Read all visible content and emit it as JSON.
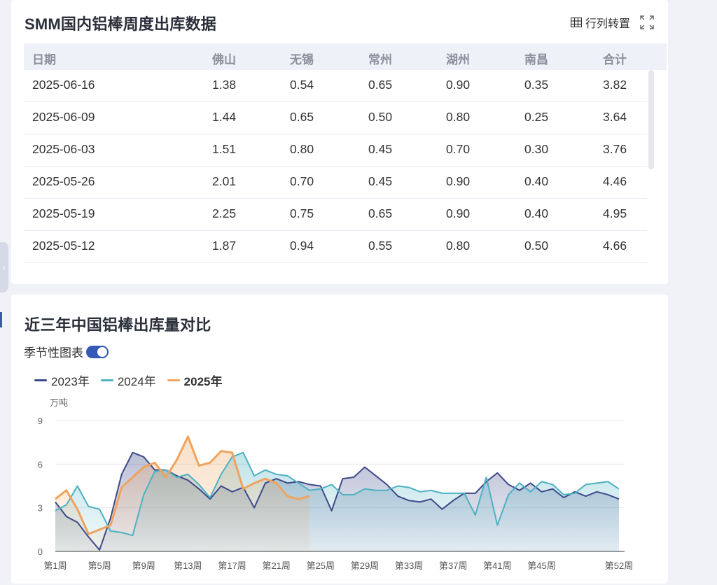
{
  "table_card": {
    "title": "SMM国内铝棒周度出库数据",
    "transpose_label": "行列转置",
    "columns": [
      "日期",
      "佛山",
      "无锡",
      "常州",
      "湖州",
      "南昌",
      "合计"
    ],
    "rows": [
      [
        "2025-06-16",
        "1.38",
        "0.54",
        "0.65",
        "0.90",
        "0.35",
        "3.82"
      ],
      [
        "2025-06-09",
        "1.44",
        "0.65",
        "0.50",
        "0.80",
        "0.25",
        "3.64"
      ],
      [
        "2025-06-03",
        "1.51",
        "0.80",
        "0.45",
        "0.70",
        "0.30",
        "3.76"
      ],
      [
        "2025-05-26",
        "2.01",
        "0.70",
        "0.45",
        "0.90",
        "0.40",
        "4.46"
      ],
      [
        "2025-05-19",
        "2.25",
        "0.75",
        "0.65",
        "0.90",
        "0.40",
        "4.95"
      ],
      [
        "2025-05-12",
        "1.87",
        "0.94",
        "0.55",
        "0.80",
        "0.50",
        "4.66"
      ]
    ]
  },
  "chart_card": {
    "title": "近三年中国铝棒出库量对比",
    "seasonal_toggle_label": "季节性图表",
    "seasonal_toggle_on": true
  },
  "chart_data": {
    "type": "line",
    "yunit": "万吨",
    "ylim": [
      0,
      9
    ],
    "yticks": [
      0,
      3,
      6,
      9
    ],
    "xtick_labels": [
      "第1周",
      "第5周",
      "第9周",
      "第13周",
      "第17周",
      "第21周",
      "第25周",
      "第29周",
      "第33周",
      "第37周",
      "第41周",
      "第45周",
      "第52周"
    ],
    "xtick_weeks": [
      1,
      5,
      9,
      13,
      17,
      21,
      25,
      29,
      33,
      37,
      41,
      45,
      52
    ],
    "grid": true,
    "legend_position": "top-left",
    "series": [
      {
        "name": "2023年",
        "color": "#3e4a89",
        "values": [
          3.4,
          2.4,
          2.0,
          1.0,
          0.1,
          2.3,
          5.3,
          6.8,
          6.5,
          5.6,
          5.6,
          5.2,
          4.9,
          4.3,
          3.6,
          4.5,
          4.1,
          4.4,
          3.0,
          4.7,
          5.0,
          4.7,
          4.8,
          4.6,
          4.5,
          2.8,
          5.0,
          5.1,
          5.8,
          5.2,
          4.6,
          3.8,
          3.5,
          3.4,
          3.6,
          2.9,
          3.5,
          4.0,
          4.0,
          4.8,
          5.4,
          4.6,
          4.2,
          4.7,
          4.1,
          4.3,
          3.7,
          4.1,
          3.8,
          4.1,
          3.9,
          3.6
        ]
      },
      {
        "name": "2024年",
        "color": "#4db1c2",
        "values": [
          2.8,
          3.2,
          4.5,
          3.1,
          2.9,
          1.4,
          1.3,
          1.1,
          3.9,
          5.5,
          5.6,
          5.1,
          5.3,
          4.6,
          3.7,
          5.3,
          6.5,
          6.8,
          5.2,
          5.6,
          5.3,
          5.2,
          4.7,
          4.2,
          4.3,
          4.6,
          3.9,
          3.9,
          4.3,
          4.2,
          4.2,
          4.5,
          4.4,
          4.1,
          4.2,
          4.0,
          4.0,
          4.0,
          2.5,
          5.1,
          1.8,
          3.9,
          4.7,
          4.1,
          4.8,
          4.6,
          3.9,
          4.0,
          4.6,
          4.7,
          4.8,
          4.3
        ]
      },
      {
        "name": "2025年",
        "color": "#eea45e",
        "values": [
          3.6,
          4.2,
          2.9,
          1.2,
          1.5,
          1.8,
          4.4,
          5.1,
          5.8,
          6.1,
          5.1,
          6.3,
          7.9,
          5.9,
          6.1,
          6.9,
          6.8,
          4.3,
          4.7,
          5.0,
          4.7,
          3.8,
          3.6,
          3.8
        ]
      }
    ]
  }
}
